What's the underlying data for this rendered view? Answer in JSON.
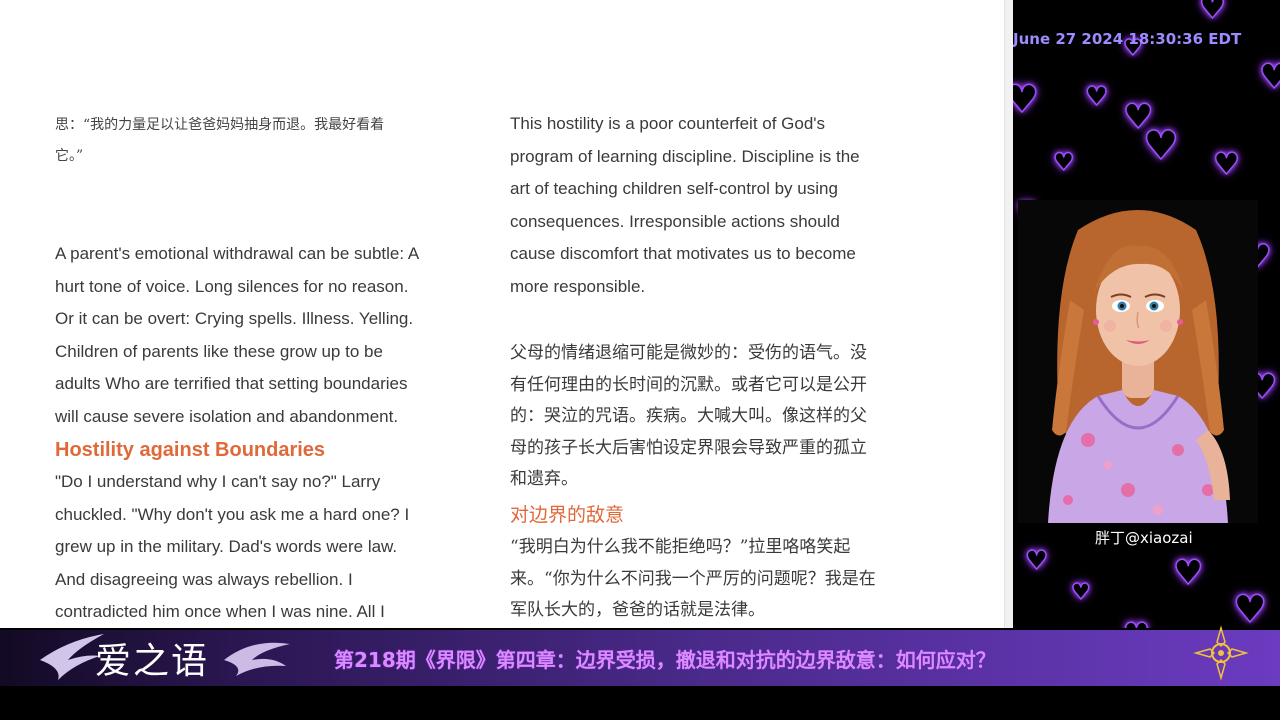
{
  "document": {
    "left_column": {
      "zh_intro_lines": [
        "思：“我的力量足以让爸爸妈妈抽身而退。我最好看着",
        "它。”"
      ],
      "para1_lines": [
        "A parent's emotional withdrawal can be subtle: A",
        "hurt tone of voice. Long silences for no reason.",
        "Or it can be overt: Crying spells. Illness. Yelling.",
        "Children of parents like these grow up to be",
        "adults Who are terrified that setting boundaries",
        "will cause severe isolation and abandonment."
      ],
      "heading": "Hostility against Boundaries",
      "para2_lines": [
        "\"Do I understand why I can't say no?\" Larry",
        "chuckled. \"Why don't you ask me a hard one? I",
        "grew up in the military. Dad's words were law.",
        "And disagreeing was always rebellion. I",
        "contradicted him once when I was nine. All I"
      ]
    },
    "right_column": {
      "para1_lines": [
        "This hostility is a poor counterfeit of God's",
        "program of learning discipline. Discipline is the",
        "art of teaching children self-control by using",
        "consequences. Irresponsible actions should",
        "cause discomfort that motivates us to become",
        "more responsible."
      ],
      "zh_para_lines": [
        "父母的情绪退缩可能是微妙的：受伤的语气。没",
        "有任何理由的长时间的沉默。或者它可以是公开",
        "的：哭泣的咒语。疾病。大喊大叫。像这样的父",
        "母的孩子长大后害怕设定界限会导致严重的孤立",
        "和遗弃。"
      ],
      "zh_heading": "对边界的敌意",
      "zh_para2_lines": [
        "“我明白为什么我不能拒绝吗？”拉里咯咯笑起",
        "来。“你为什么不问我一个严厉的问题呢？我是在",
        "军队长大的，爸爸的话就是法律。"
      ]
    }
  },
  "overlay": {
    "timestamp": "June 27 2024 18:30:36 EDT",
    "handle": "胖丁@xiaozai",
    "logo_text": "爱之语",
    "episode_title": "第218期《界限》第四章：边界受损，撤退和对抗的边界敌意：如何应对？",
    "colors": {
      "accent_orange": "#e0693a",
      "heart_glow": "#9b4dff",
      "timestamp": "#9d8cff",
      "banner_text": "#d98bff"
    },
    "icons": [
      "heart-icon",
      "logo-swirl-icon",
      "emblem-icon"
    ]
  }
}
